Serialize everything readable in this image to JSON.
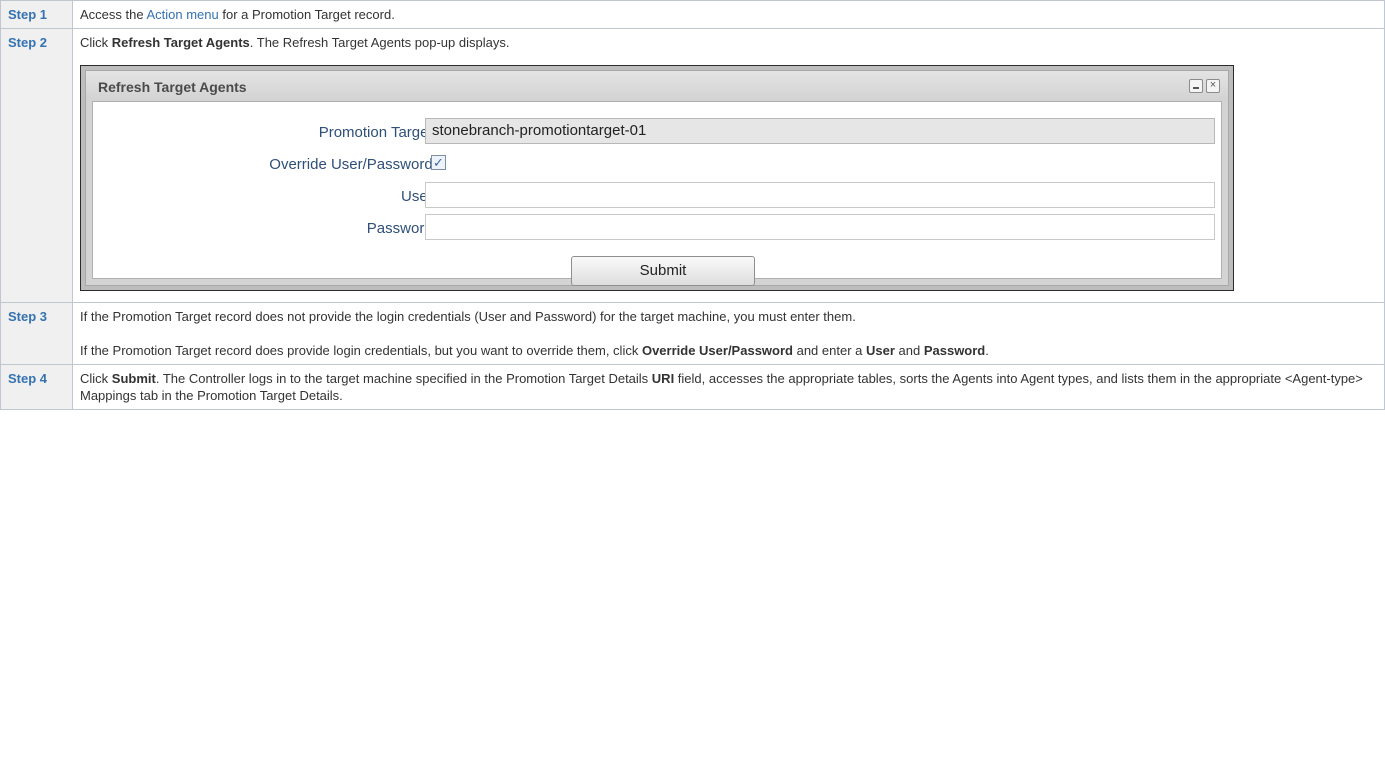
{
  "steps": [
    {
      "label": "Step 1",
      "pre": "Access the ",
      "link": "Action menu",
      "post": " for a Promotion Target record."
    },
    {
      "label": "Step 2",
      "pre": "Click ",
      "bold": "Refresh Target Agents",
      "post": ". The Refresh Target Agents pop-up displays."
    },
    {
      "label": "Step 3",
      "p1": "If the Promotion Target record does not provide the login credentials (User and Password) for the target machine, you must enter them.",
      "p2_pre": "If the Promotion Target record does provide login credentials, but you want to override them, click ",
      "p2_bold1": "Override User/Password",
      "p2_mid": " and enter a ",
      "p2_bold2": "User",
      "p2_and": " and ",
      "p2_bold3": "Password",
      "p2_end": "."
    },
    {
      "label": "Step 4",
      "pre": "Click ",
      "bold1": "Submit",
      "mid": ". The Controller logs in to the target machine specified in the Promotion Target Details ",
      "bold2": "URI",
      "post": " field, accesses the appropriate tables, sorts the Agents into Agent types, and lists them in the appropriate <Agent-type> Mappings tab in the Promotion Target Details."
    }
  ],
  "dialog": {
    "title": "Refresh Target Agents",
    "minimize_glyph": "",
    "close_glyph": "×",
    "fields": {
      "promotion_target_label": "Promotion Target :",
      "promotion_target_value": "stonebranch-promotiontarget-01",
      "override_label": "Override User/Password :",
      "override_checked_glyph": "✓",
      "user_label": "User :",
      "user_value": "",
      "password_label": "Password :",
      "password_value": ""
    },
    "submit_label": "Submit"
  }
}
